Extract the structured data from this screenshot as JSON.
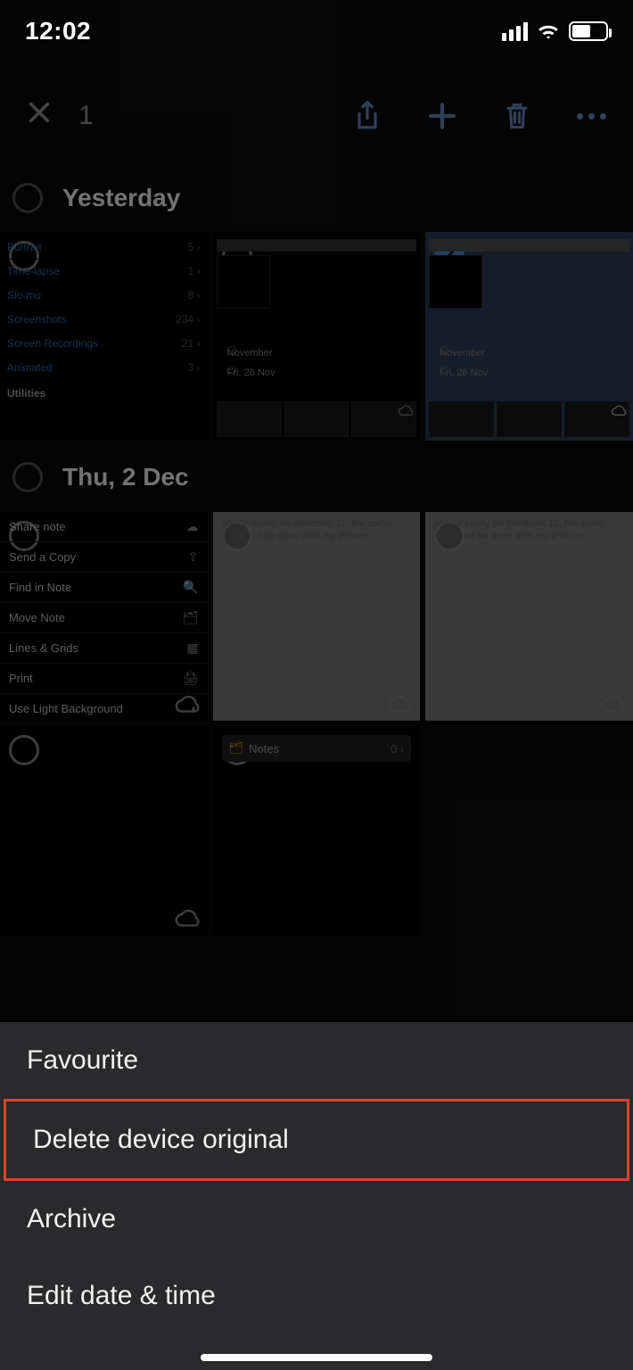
{
  "status": {
    "time": "12:02"
  },
  "toolbar": {
    "selected_count": "1"
  },
  "sections": {
    "yesterday": {
      "title": "Yesterday"
    },
    "thu": {
      "title": "Thu, 2 Dec"
    }
  },
  "media_types": {
    "items": [
      {
        "label": "Portrait",
        "count": "5"
      },
      {
        "label": "Time-lapse",
        "count": "1"
      },
      {
        "label": "Slo-mo",
        "count": "8"
      },
      {
        "label": "Screenshots",
        "count": "234"
      },
      {
        "label": "Screen Recordings",
        "count": "21"
      },
      {
        "label": "Animated",
        "count": "3"
      }
    ],
    "section": "Utilities"
  },
  "mini_photos": {
    "month": "November",
    "date": "Fri, 26 Nov"
  },
  "link_preview": {
    "text": "phone easily on Windows 11, the same could not be done with my iPhone."
  },
  "notes_menu": {
    "items": [
      {
        "label": "Share note"
      },
      {
        "label": "Send a Copy"
      },
      {
        "label": "Find in Note"
      },
      {
        "label": "Move Note"
      },
      {
        "label": "Lines & Grids"
      },
      {
        "label": "Print"
      },
      {
        "label": "Use Light Background"
      }
    ]
  },
  "notes_folder": {
    "label": "Notes",
    "count": "0"
  },
  "action_sheet": {
    "items": [
      {
        "label": "Favourite"
      },
      {
        "label": "Delete device original",
        "highlight": true
      },
      {
        "label": "Archive"
      },
      {
        "label": "Edit date & time"
      }
    ]
  }
}
